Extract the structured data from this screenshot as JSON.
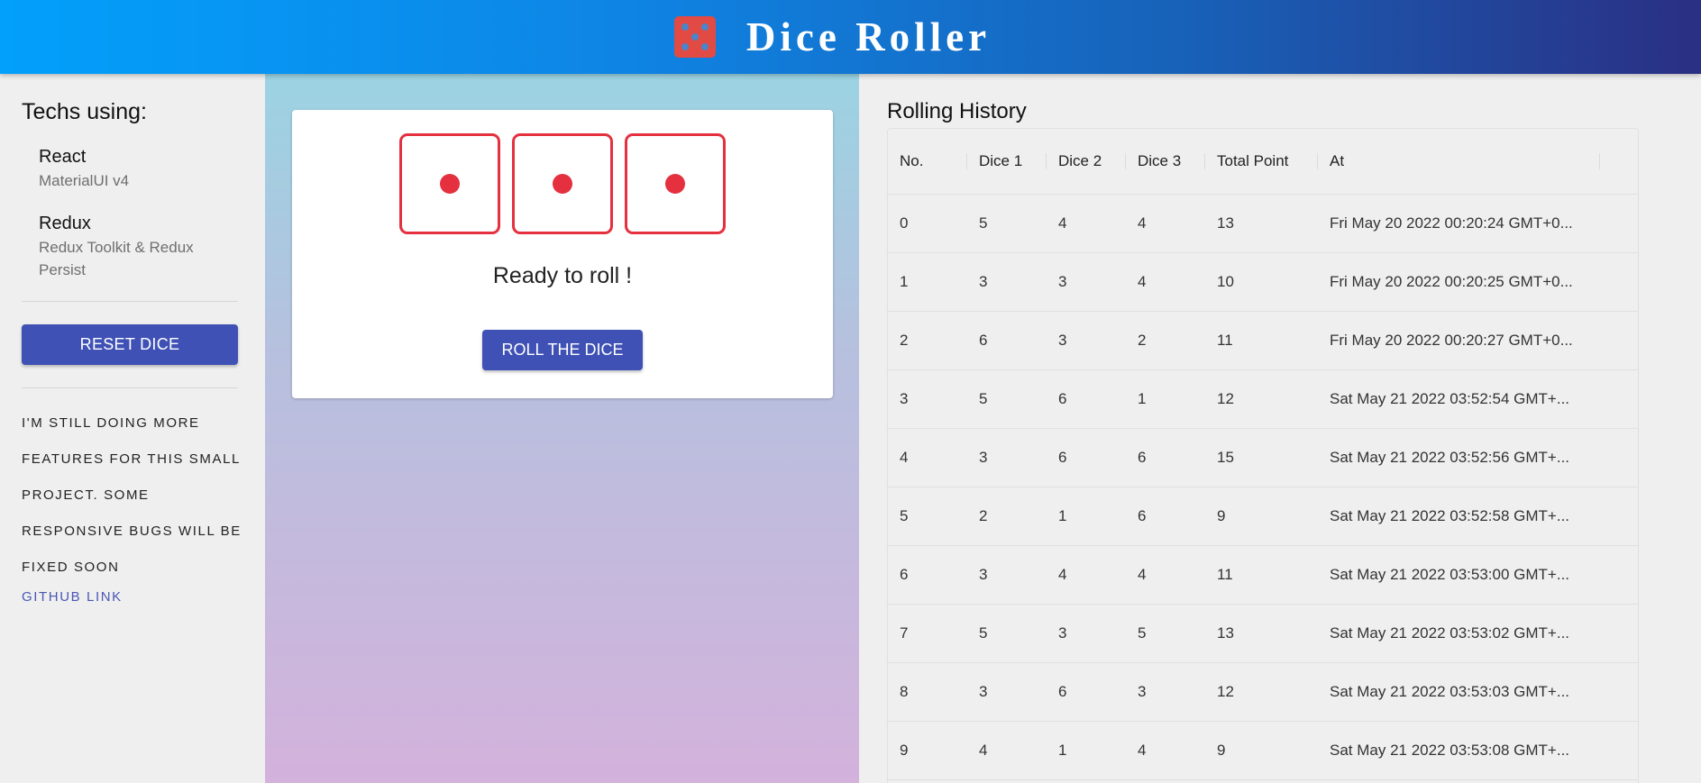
{
  "header": {
    "title": "Dice Roller",
    "logo_icon": "dice-five-icon",
    "colors": {
      "gradient_start": "#02a0fb",
      "gradient_end": "#2a2f83",
      "logo": "#e24a44"
    }
  },
  "sidebar": {
    "heading": "Techs using:",
    "techs": [
      {
        "name": "React",
        "desc": "MaterialUI v4"
      },
      {
        "name": "Redux",
        "desc": "Redux Toolkit & Redux Persist"
      }
    ],
    "reset_label": "RESET DICE",
    "note": "I'M STILL DOING MORE FEATURES FOR THIS SMALL PROJECT. SOME RESPONSIVE BUGS WILL BE FIXED SOON",
    "github_label": "GITHUB LINK"
  },
  "game": {
    "dice": [
      1,
      1,
      1
    ],
    "status": "Ready to roll !",
    "roll_label": "ROLL THE DICE",
    "colors": {
      "die": "#e4303f",
      "button": "#3f51b5"
    }
  },
  "history": {
    "title": "Rolling History",
    "columns": [
      "No.",
      "Dice 1",
      "Dice 2",
      "Dice 3",
      "Total Point",
      "At"
    ],
    "rows": [
      [
        "0",
        "5",
        "4",
        "4",
        "13",
        "Fri May 20 2022 00:20:24 GMT+0..."
      ],
      [
        "1",
        "3",
        "3",
        "4",
        "10",
        "Fri May 20 2022 00:20:25 GMT+0..."
      ],
      [
        "2",
        "6",
        "3",
        "2",
        "11",
        "Fri May 20 2022 00:20:27 GMT+0..."
      ],
      [
        "3",
        "5",
        "6",
        "1",
        "12",
        "Sat May 21 2022 03:52:54 GMT+..."
      ],
      [
        "4",
        "3",
        "6",
        "6",
        "15",
        "Sat May 21 2022 03:52:56 GMT+..."
      ],
      [
        "5",
        "2",
        "1",
        "6",
        "9",
        "Sat May 21 2022 03:52:58 GMT+..."
      ],
      [
        "6",
        "3",
        "4",
        "4",
        "11",
        "Sat May 21 2022 03:53:00 GMT+..."
      ],
      [
        "7",
        "5",
        "3",
        "5",
        "13",
        "Sat May 21 2022 03:53:02 GMT+..."
      ],
      [
        "8",
        "3",
        "6",
        "3",
        "12",
        "Sat May 21 2022 03:53:03 GMT+..."
      ],
      [
        "9",
        "4",
        "1",
        "4",
        "9",
        "Sat May 21 2022 03:53:08 GMT+..."
      ]
    ]
  }
}
